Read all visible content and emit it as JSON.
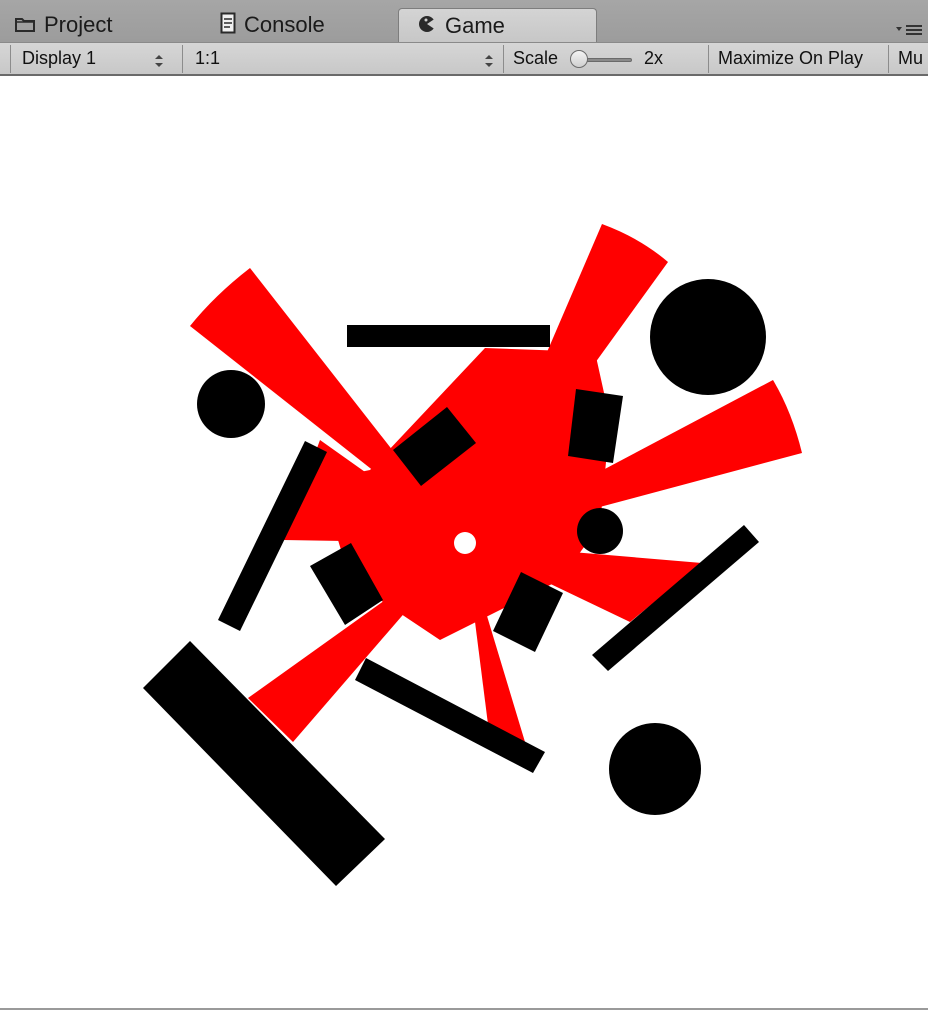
{
  "tabs": [
    {
      "label": "Project",
      "icon": "folder-icon",
      "active": false
    },
    {
      "label": "Console",
      "icon": "console-icon",
      "active": false
    },
    {
      "label": "Game",
      "icon": "game-controller-icon",
      "active": true
    }
  ],
  "tab_menu_icon": "tab-menu-icon",
  "toolbar": {
    "display_select": "Display 1",
    "aspect_select": "1:1",
    "scale_label": "Scale",
    "scale_value_label": "2x",
    "maximize_label": "Maximize On Play",
    "mute_label": "Mu"
  },
  "colors": {
    "shape_red": "#ff0000",
    "shape_black": "#000000",
    "game_background": "#ffffff",
    "tab_active": "#d0d0d0",
    "chrome_dark": "#a2a2a2"
  },
  "game_scene": {
    "red_blades": 8,
    "black_circles": 4,
    "black_rectangles": 9,
    "center_hole": "white-dot"
  }
}
